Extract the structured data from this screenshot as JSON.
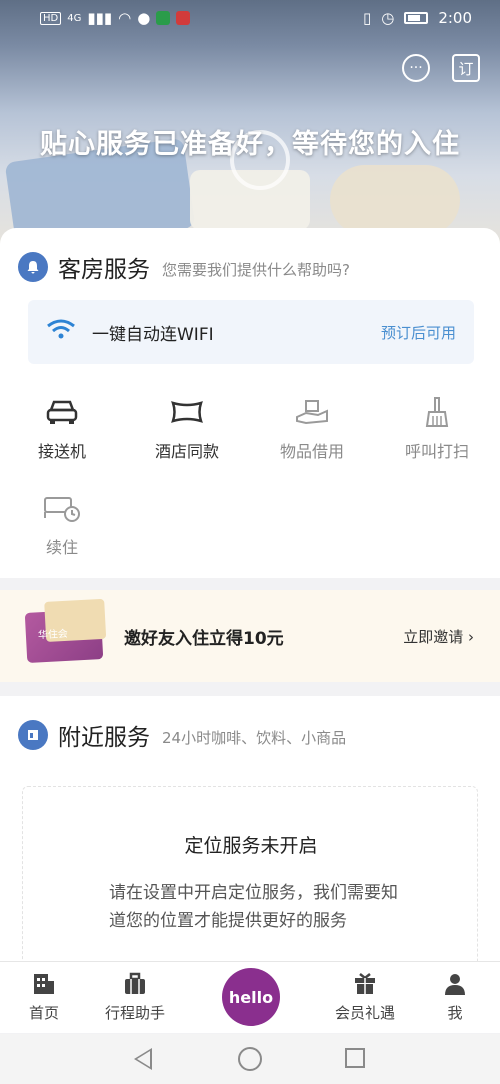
{
  "status_bar": {
    "network_badge": "HD",
    "network_type": "4G",
    "time": "2:00"
  },
  "hero": {
    "title": "贴心服务已准备好，等待您的入住",
    "chat_icon": "chat-bubble-icon",
    "order_icon_text": "订"
  },
  "room_service": {
    "title": "客房服务",
    "subtitle": "您需要我们提供什么帮助吗?",
    "wifi": {
      "label": "一键自动连WIFI",
      "status": "预订后可用"
    },
    "items": [
      {
        "label": "接送机",
        "icon": "car-icon",
        "dim": false
      },
      {
        "label": "酒店同款",
        "icon": "pillow-icon",
        "dim": false
      },
      {
        "label": "物品借用",
        "icon": "hand-box-icon",
        "dim": true
      },
      {
        "label": "呼叫打扫",
        "icon": "broom-icon",
        "dim": true
      },
      {
        "label": "续住",
        "icon": "bed-clock-icon",
        "dim": true
      }
    ]
  },
  "invite": {
    "card_brand": "华住会",
    "text": "邀好友入住立得10元",
    "link": "立即邀请"
  },
  "nearby": {
    "title": "附近服务",
    "subtitle": "24小时咖啡、饮料、小商品",
    "location_title": "定位服务未开启",
    "location_desc": "请在设置中开启定位服务，我们需要知道您的位置才能提供更好的服务"
  },
  "tabbar": {
    "items": [
      {
        "label": "首页",
        "icon": "home-building-icon"
      },
      {
        "label": "行程助手",
        "icon": "suitcase-icon"
      },
      {
        "label": "hello",
        "icon": "hello-bubble-icon"
      },
      {
        "label": "会员礼遇",
        "icon": "gift-icon"
      },
      {
        "label": "我",
        "icon": "person-icon"
      }
    ]
  },
  "colors": {
    "accent": "#4a78c2",
    "brand_purple": "#8a2f8e",
    "wifi_blue": "#2d83d4"
  }
}
